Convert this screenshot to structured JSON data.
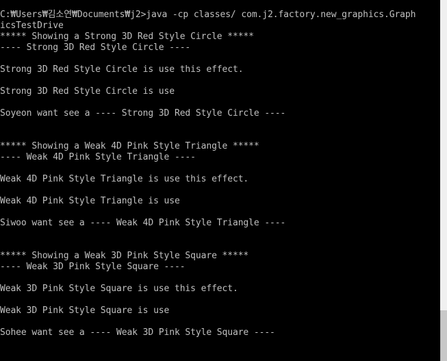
{
  "console": {
    "lines": [
      "C:₩Users₩김소연₩Documents₩j2>java -cp classes/ com.j2.factory.new_graphics.Graph",
      "icsTestDrive",
      "***** Showing a Strong 3D Red Style Circle *****",
      "---- Strong 3D Red Style Circle ----",
      "",
      "Strong 3D Red Style Circle is use this effect.",
      "",
      "Strong 3D Red Style Circle is use",
      "",
      "Soyeon want see a ---- Strong 3D Red Style Circle ----",
      "",
      "",
      "***** Showing a Weak 4D Pink Style Triangle *****",
      "---- Weak 4D Pink Style Triangle ----",
      "",
      "Weak 4D Pink Style Triangle is use this effect.",
      "",
      "Weak 4D Pink Style Triangle is use",
      "",
      "Siwoo want see a ---- Weak 4D Pink Style Triangle ----",
      "",
      "",
      "***** Showing a Weak 3D Pink Style Square *****",
      "---- Weak 3D Pink Style Square ----",
      "",
      "Weak 3D Pink Style Square is use this effect.",
      "",
      "Weak 3D Pink Style Square is use",
      "",
      "Sohee want see a ---- Weak 3D Pink Style Square ----"
    ]
  },
  "colors": {
    "background": "#000000",
    "text": "#c0c0c0",
    "scrollbar_track": "#f0f0f0",
    "scrollbar_thumb": "#c8c8c8"
  }
}
